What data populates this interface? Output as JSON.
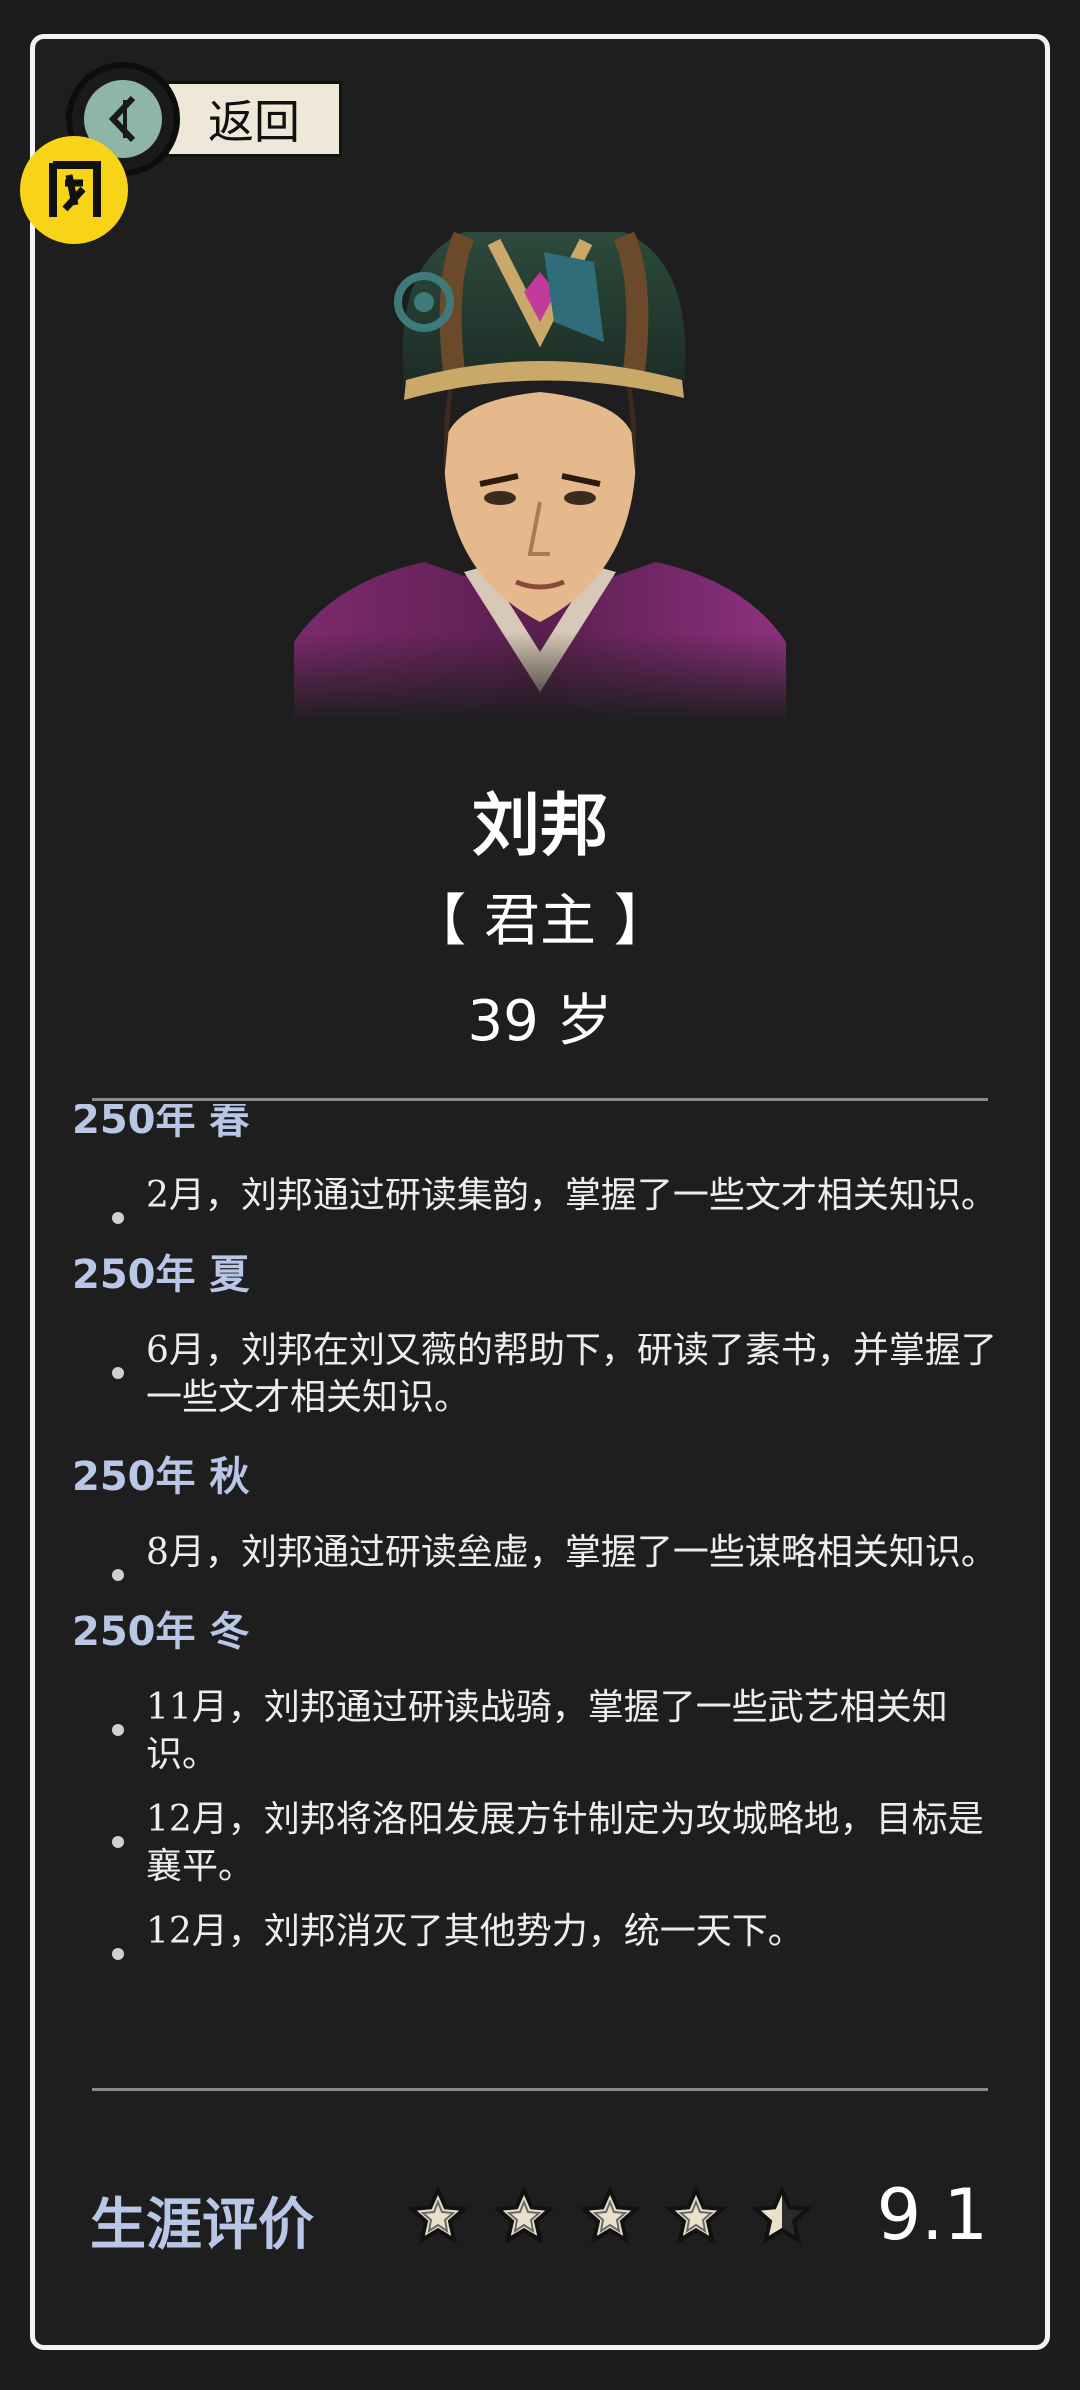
{
  "header": {
    "back_label": "返回"
  },
  "character": {
    "name": "刘邦",
    "role": "【 君主 】",
    "age": "39 岁"
  },
  "log": {
    "entries": [
      {
        "season": "250年 春",
        "events": [
          "2月，刘邦通过研读集韵，掌握了一些文才相关知识。"
        ]
      },
      {
        "season": "250年 夏",
        "events": [
          "6月，刘邦在刘又薇的帮助下，研读了素书，并掌握了一些文才相关知识。"
        ]
      },
      {
        "season": "250年 秋",
        "events": [
          "8月，刘邦通过研读垒虚，掌握了一些谋略相关知识。"
        ]
      },
      {
        "season": "250年 冬",
        "events": [
          "11月，刘邦通过研读战骑，掌握了一些武艺相关知识。",
          "12月，刘邦将洛阳发展方针制定为攻城略地，目标是襄平。",
          "12月，刘邦消灭了其他势力，统一天下。"
        ]
      }
    ]
  },
  "rating": {
    "label": "生涯评价",
    "score": "9.1",
    "stars": 4.5,
    "max_stars": 5
  },
  "colors": {
    "accent": "#b9c7e6",
    "badge": "#f7d417",
    "star_fill": "#e9e1c9"
  }
}
